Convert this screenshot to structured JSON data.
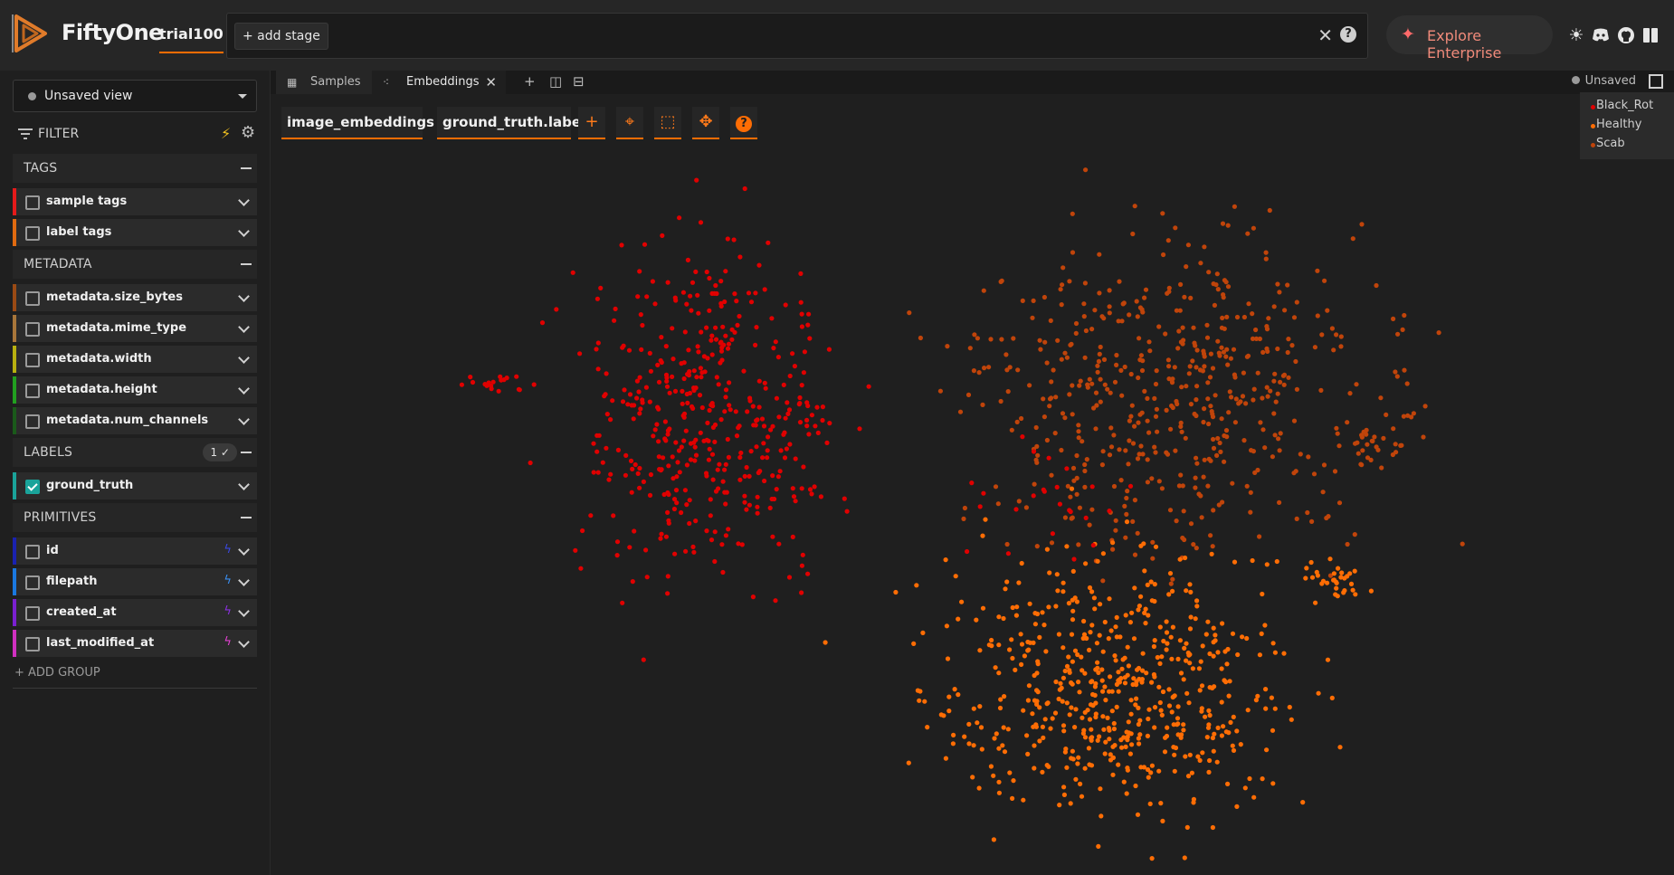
{
  "app": {
    "brand": "FiftyOne",
    "dataset": "trial100",
    "add_stage": "+ add stage",
    "enterprise": "Explore Enterprise"
  },
  "sidebar": {
    "view_label": "Unsaved view",
    "filter_label": "FILTER",
    "groups": {
      "tags": "TAGS",
      "metadata": "METADATA",
      "labels": "LABELS",
      "labels_badge": "1 ✓",
      "primitives": "PRIMITIVES"
    },
    "fields": {
      "sample_tags": "sample tags",
      "label_tags": "label tags",
      "size_bytes": "metadata.size_bytes",
      "mime_type": "metadata.mime_type",
      "width": "metadata.width",
      "height": "metadata.height",
      "num_channels": "metadata.num_channels",
      "ground_truth": "ground_truth",
      "id": "id",
      "filepath": "filepath",
      "created_at": "created_at",
      "last_modified_at": "last_modified_at"
    },
    "add_group": "+ ADD GROUP"
  },
  "tabs": {
    "samples": "Samples",
    "embeddings": "Embeddings"
  },
  "panel": {
    "unsaved": "Unsaved",
    "brain_key": "image_embeddings",
    "color_by": "ground_truth.label"
  },
  "legend": {
    "items": [
      {
        "label": "Black_Rot",
        "color": "#e00000"
      },
      {
        "label": "Healthy",
        "color": "#ff6d04"
      },
      {
        "label": "Scab",
        "color": "#c0440a"
      }
    ]
  },
  "colors": {
    "accent": "#ff6d04",
    "black_rot": "#e00000",
    "healthy": "#ff6d04",
    "scab": "#c0440a"
  }
}
